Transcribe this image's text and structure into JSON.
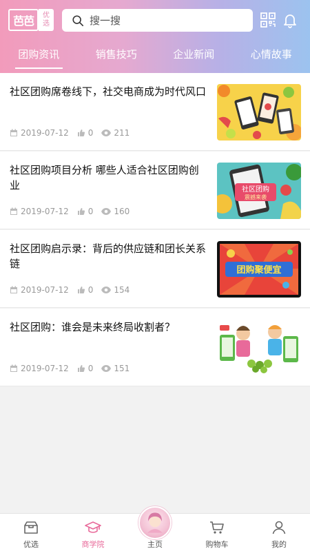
{
  "header": {
    "logo_main": "芭芭",
    "logo_sub_1": "优",
    "logo_sub_2": "选",
    "search_placeholder": "搜一搜"
  },
  "tabs": [
    {
      "label": "团购资讯",
      "active": true
    },
    {
      "label": "销售技巧",
      "active": false
    },
    {
      "label": "企业新闻",
      "active": false
    },
    {
      "label": "心情故事",
      "active": false
    }
  ],
  "articles": [
    {
      "title": "社区团购席卷线下，社交电商成为时代风口",
      "date": "2019-07-12",
      "likes": "0",
      "views": "211",
      "thumb": "fruit-phones"
    },
    {
      "title": "社区团购项目分析 哪些人适合社区团购创业",
      "date": "2019-07-12",
      "likes": "0",
      "views": "160",
      "thumb": "shequ-tuangou"
    },
    {
      "title": "社区团购启示录：背后的供应链和团长关系链",
      "date": "2019-07-12",
      "likes": "0",
      "views": "154",
      "thumb": "tuangou-banner"
    },
    {
      "title": "社区团购：谁会是未来终局收割者？",
      "date": "2019-07-12",
      "likes": "0",
      "views": "151",
      "thumb": "cartoon-people"
    }
  ],
  "thumb_texts": {
    "t2": "社区团购",
    "t2b": "震撼来袭",
    "t3": "团购聚便宜"
  },
  "tabbar": [
    {
      "label": "优选",
      "icon": "box-icon",
      "active": false
    },
    {
      "label": "商学院",
      "icon": "graduation-cap-icon",
      "active": true
    },
    {
      "label": "主页",
      "icon": "home-avatar-icon",
      "active": false
    },
    {
      "label": "购物车",
      "icon": "cart-icon",
      "active": false
    },
    {
      "label": "我的",
      "icon": "user-icon",
      "active": false
    }
  ],
  "colors": {
    "accent": "#e86a9a",
    "header_start": "#f29bbb",
    "header_end": "#9cc3ef"
  }
}
